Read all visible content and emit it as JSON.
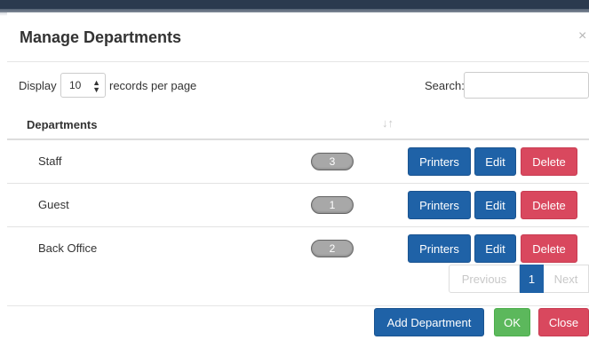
{
  "dialog": {
    "title": "Manage Departments",
    "close_glyph": "×"
  },
  "controls": {
    "display_label": "Display",
    "length_value": "10",
    "records_label": "records per page",
    "search_label": "Search:",
    "search_value": ""
  },
  "table": {
    "header": "Departments",
    "sort_icon": "sort-icon",
    "rows": [
      {
        "name": "Staff",
        "count": "3"
      },
      {
        "name": "Guest",
        "count": "1"
      },
      {
        "name": "Back Office",
        "count": "2"
      }
    ],
    "printers_label": "Printers",
    "edit_label": "Edit",
    "delete_label": "Delete"
  },
  "pagination": {
    "previous": "Previous",
    "current": "1",
    "next": "Next"
  },
  "footer": {
    "add_label": "Add Department",
    "ok_label": "OK",
    "close_label": "Close"
  },
  "colors": {
    "primary": "#1f62a7",
    "danger": "#d9485e",
    "success": "#5cb85c",
    "badge": "#a8a8a8"
  }
}
